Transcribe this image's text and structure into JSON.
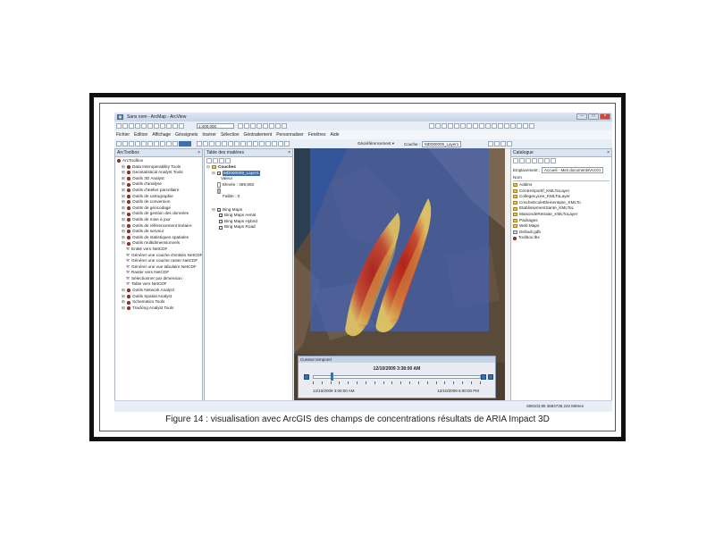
{
  "window": {
    "title": "Sans nom - ArcMap - ArcView",
    "min_symbol": "–",
    "max_symbol": "□",
    "close_symbol": "×"
  },
  "toolbar": {
    "scale_value": "1:400,000"
  },
  "menu": [
    "Fichier",
    "Edition",
    "Affichage",
    "Géosignets",
    "Insérer",
    "Sélection",
    "Géotraitement",
    "Personnaliser",
    "Fenêtres",
    "Aide"
  ],
  "georef": {
    "label": "Géoréférencement ▾",
    "layer_label": "Couche :",
    "layer_value": "MD000009_Layer1"
  },
  "arctoolbox": {
    "title": "ArcToolbox",
    "close_symbol": "×",
    "items": [
      {
        "label": "ArcToolbox",
        "kind": "root",
        "indent": 0
      },
      {
        "label": "Data Interoperability Tools",
        "kind": "box",
        "indent": 1
      },
      {
        "label": "Geostatistical Analyst Tools",
        "kind": "box",
        "indent": 1
      },
      {
        "label": "Outils 3D Analyst",
        "kind": "box",
        "indent": 1
      },
      {
        "label": "Outils d'analyse",
        "kind": "box",
        "indent": 1
      },
      {
        "label": "Outils d'atelier parcellaire",
        "kind": "box",
        "indent": 1
      },
      {
        "label": "Outils de cartographie",
        "kind": "box",
        "indent": 1
      },
      {
        "label": "Outils de conversion",
        "kind": "box",
        "indent": 1
      },
      {
        "label": "Outils de géocodage",
        "kind": "box",
        "indent": 1
      },
      {
        "label": "Outils de gestion des données",
        "kind": "box",
        "indent": 1
      },
      {
        "label": "Outils de mise à jour",
        "kind": "box",
        "indent": 1
      },
      {
        "label": "Outils de référencement linéaire",
        "kind": "box",
        "indent": 1
      },
      {
        "label": "Outils de serveur",
        "kind": "box",
        "indent": 1
      },
      {
        "label": "Outils de statistiques spatiales",
        "kind": "box",
        "indent": 1
      },
      {
        "label": "Outils multidimensionnels",
        "kind": "box-open",
        "indent": 1
      },
      {
        "label": "Entité vers NetCDF",
        "kind": "tool",
        "indent": 2
      },
      {
        "label": "Générer une couche d'entités NetCDF",
        "kind": "tool",
        "indent": 2
      },
      {
        "label": "Générer une couche raster NetCDF",
        "kind": "tool",
        "indent": 2
      },
      {
        "label": "Générer une vue tabulaire NetCDF",
        "kind": "tool",
        "indent": 2
      },
      {
        "label": "Raster vers NetCDF",
        "kind": "tool",
        "indent": 2
      },
      {
        "label": "Sélectionner par dimension",
        "kind": "tool",
        "indent": 2
      },
      {
        "label": "Table vers NetCDF",
        "kind": "tool",
        "indent": 2
      },
      {
        "label": "Outils Network Analyst",
        "kind": "box",
        "indent": 1
      },
      {
        "label": "Outils Spatial Analyst",
        "kind": "box",
        "indent": 1
      },
      {
        "label": "Schematics Tools",
        "kind": "box",
        "indent": 1
      },
      {
        "label": "Tracking Analyst Tools",
        "kind": "box",
        "indent": 1
      }
    ]
  },
  "toc": {
    "title": "Table des matières",
    "close_symbol": "×",
    "root": "Couches",
    "layer_name": "MD000009_Layer1",
    "value_label": "Valeur",
    "high_label": "Elevée : 489,892",
    "low_label": "Faible : 0",
    "basemap_group": "Bing Maps",
    "basemaps": [
      {
        "label": "Bing Maps Aerial",
        "checked": true
      },
      {
        "label": "Bing Maps Hybrid",
        "checked": false
      },
      {
        "label": "Bing Maps Road",
        "checked": false
      }
    ],
    "checked_symbol": "✓"
  },
  "timeslider": {
    "title": "Curseur temporel",
    "current": "12/10/2009 3:38:00 AM",
    "start": "12/10/2009 3:00:00 AM",
    "end": "12/10/2009 6:00:00 PM"
  },
  "catalog": {
    "title": "Catalogue",
    "close_symbol": "×",
    "location_label": "Emplacement :",
    "location_value": "Accueil - Mes documents\\ArcGI",
    "header": "Nom",
    "items": [
      {
        "label": "Addins",
        "kind": "folder"
      },
      {
        "label": "CentreSportif_KMLToLayer",
        "kind": "folder"
      },
      {
        "label": "CollegeLycee_KMLToLayer",
        "kind": "folder"
      },
      {
        "label": "CrecheEcoleElementaire_KMLTo",
        "kind": "folder"
      },
      {
        "label": "EtablissementSante_KMLToL",
        "kind": "folder"
      },
      {
        "label": "MaisondeRetraite_KMLToLayer",
        "kind": "folder"
      },
      {
        "label": "Packages",
        "kind": "folder"
      },
      {
        "label": "Web Maps",
        "kind": "folder"
      },
      {
        "label": "Default.gdb",
        "kind": "gdb"
      },
      {
        "label": "Toolbox.tbx",
        "kind": "toolbox"
      }
    ]
  },
  "status": {
    "coords": "608103,85  3684735,222 Mètres"
  },
  "caption": "Figure 14 : visualisation avec ArcGIS des champs de concentrations résultats de ARIA Impact 3D",
  "colors": {
    "title_bar": "#c5d4e8",
    "overlay_blue": "#3c64c8",
    "plume_red": "#c02818",
    "plume_yellow": "#e6c850",
    "toolbox_red": "#c0392b",
    "folder": "#e8c060",
    "selection": "#3a6fb0"
  }
}
